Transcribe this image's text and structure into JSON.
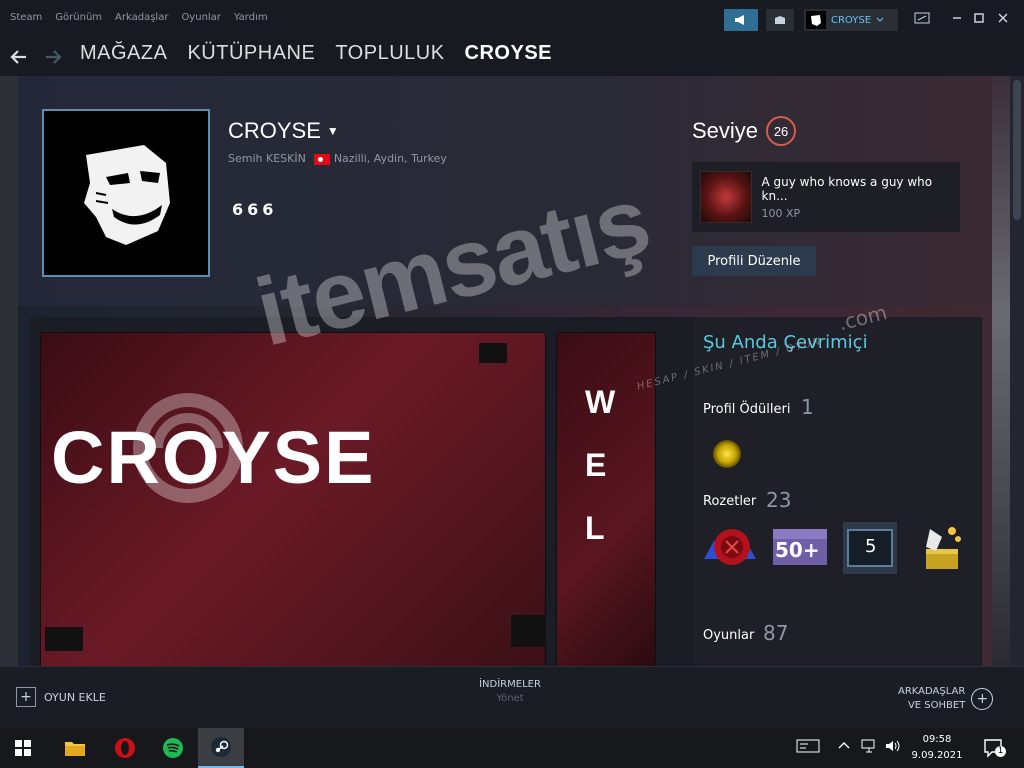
{
  "menubar": {
    "menus": [
      "Steam",
      "Görünüm",
      "Arkadaşlar",
      "Oyunlar",
      "Yardım"
    ],
    "username": "CROYSE",
    "icons": [
      "megaphone-icon",
      "envelope-icon",
      "chevron-down-icon",
      "window-resize-icon",
      "minimize-icon",
      "maximize-icon",
      "close-icon"
    ]
  },
  "nav": {
    "links": [
      "MAĞAZA",
      "KÜTÜPHANE",
      "TOPLULUK",
      "CROYSE"
    ],
    "active_index": 3,
    "back_icon": "arrow-left-icon",
    "forward_icon": "arrow-right-icon"
  },
  "profile": {
    "persona_name": "CROYSE",
    "real_name": "Semih KESKİN",
    "location": "Nazilli, Aydin, Turkey",
    "summary": "666",
    "level_label": "Seviye",
    "level": "26",
    "featured_badge": {
      "name": "A guy who knows a guy who kn...",
      "xp": "100 XP"
    },
    "edit_button": "Profili Düzenle"
  },
  "showcase": {
    "art_title": "CROYSE",
    "side_letters": [
      "W",
      "E",
      "L"
    ]
  },
  "sidebar": {
    "status": "Şu Anda Çevrimiçi",
    "awards_label": "Profil Ödülleri",
    "awards_count": "1",
    "badges_label": "Rozetler",
    "badges_count": "23",
    "badge_icons": [
      "wax-seal-badge-icon",
      "fifty-plus-badge-icon",
      "years-service-badge-icon",
      "treasure-badge-icon"
    ],
    "badge_five_label": "5",
    "badge_fifty_label": "50+",
    "games_label": "Oyunlar",
    "games_count": "87"
  },
  "bottombar": {
    "add_game": "OYUN EKLE",
    "downloads_title": "İNDİRMELER",
    "downloads_sub": "Yönet",
    "friends_line1": "ARKADAŞLAR",
    "friends_line2": "VE SOHBET"
  },
  "taskbar": {
    "apps": [
      "windows-start-icon",
      "file-explorer-icon",
      "opera-icon",
      "spotify-icon",
      "steam-icon"
    ],
    "time": "09:58",
    "date": "9.09.2021",
    "notification_count": "1"
  },
  "watermark": {
    "brand": "itemsatış",
    "domain": ".com",
    "tagline": "HESAP / SKIN / ITEM / OYUN"
  },
  "colors": {
    "accent_blue": "#67c1f5",
    "status_cyan": "#57cbde",
    "level_ring": "#d45d4b",
    "background": "#171a21"
  }
}
